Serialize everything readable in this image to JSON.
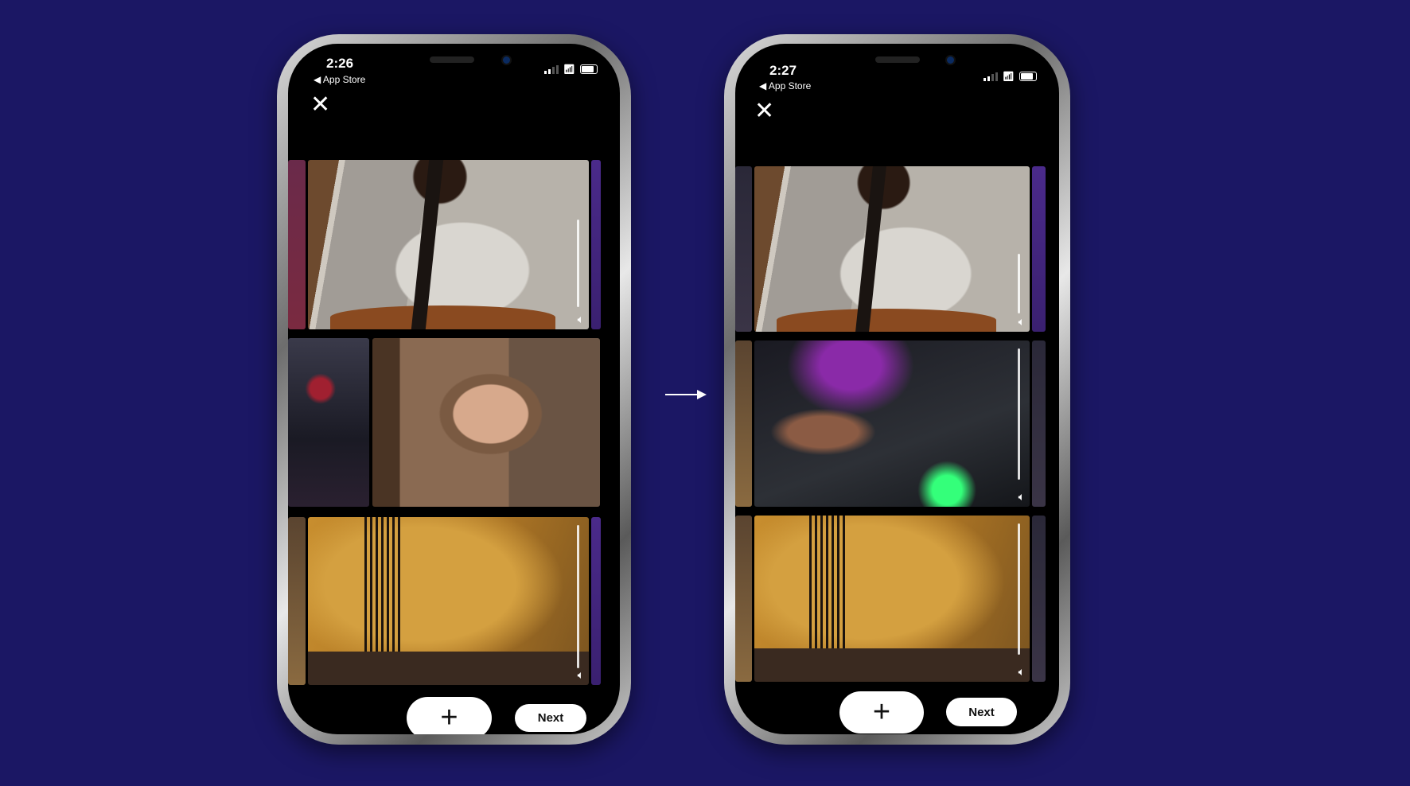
{
  "background_color": "#1b1764",
  "transition_arrow": "arrow-right-icon",
  "phones": [
    {
      "status": {
        "time": "2:26",
        "back_label": "App Store",
        "icons": [
          "signal-icon",
          "wifi-icon",
          "battery-icon"
        ]
      },
      "close_icon": "close-icon",
      "tiles": [
        "cellist-video",
        "vocalist-video",
        "bassist-video"
      ],
      "add_button": {
        "label": "+",
        "icon": "plus-icon"
      },
      "next_button": {
        "label": "Next"
      }
    },
    {
      "status": {
        "time": "2:27",
        "back_label": "App Store",
        "icons": [
          "signal-icon",
          "wifi-icon",
          "battery-icon"
        ]
      },
      "close_icon": "close-icon",
      "tiles": [
        "cellist-video",
        "mixer-video",
        "bassist-video"
      ],
      "add_button": {
        "label": "+",
        "icon": "plus-icon"
      },
      "next_button": {
        "label": "Next"
      }
    }
  ]
}
